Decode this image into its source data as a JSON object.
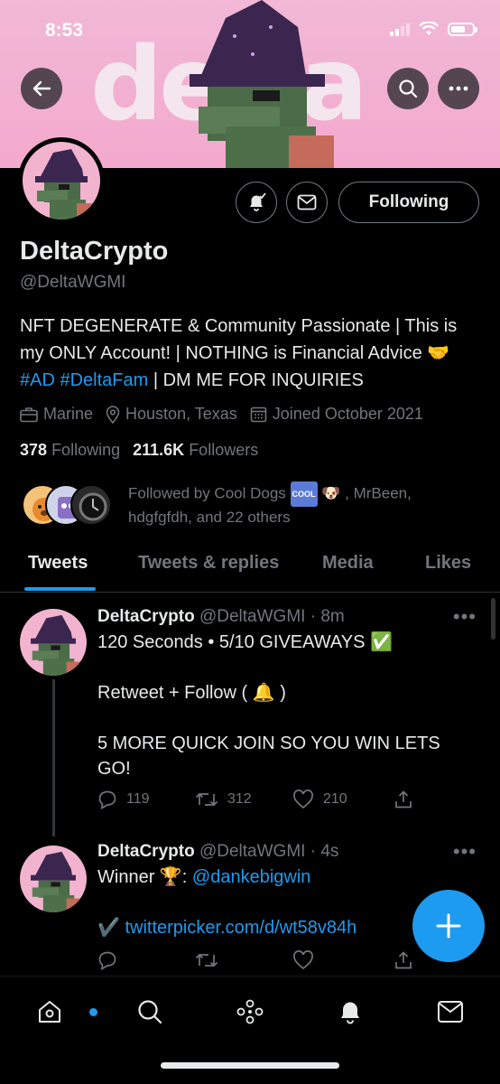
{
  "status_bar": {
    "time": "8:53"
  },
  "banner": {
    "word": "delta"
  },
  "profile": {
    "name": "DeltaCrypto",
    "handle": "@DeltaWGMI",
    "follow_button": "Following",
    "bio_line1": "NFT DEGENERATE & Community Passionate | This is my ONLY Account! | NOTHING is Financial Advice 🤝",
    "bio_tag1": "#AD",
    "bio_tag2": "#DeltaFam",
    "bio_rest": " | DM ME FOR INQUIRIES",
    "category": "Marine",
    "location": "Houston, Texas",
    "joined": "Joined October 2021",
    "following_count": "378",
    "following_label": "Following",
    "followers_count": "211.6K",
    "followers_label": "Followers",
    "followed_by_prefix": "Followed by Cool Dogs ",
    "followed_by_badge": "COOL",
    "followed_by_suffix": "🐶 , MrBeen, hdgfgfdh, and 22 others"
  },
  "tabs": [
    "Tweets",
    "Tweets & replies",
    "Media",
    "Likes"
  ],
  "tweets": [
    {
      "name": "DeltaCrypto",
      "meta": "@DeltaWGMI · 8m",
      "line1": "120 Seconds • 5/10 GIVEAWAYS ✅",
      "line2": "Retweet + Follow ( 🔔 )",
      "line3": "5 MORE QUICK JOIN SO YOU WIN LETS GO!",
      "replies": "119",
      "retweets": "312",
      "likes": "210"
    },
    {
      "name": "DeltaCrypto",
      "meta": "@DeltaWGMI · 4s",
      "line1_text": "Winner 🏆: ",
      "line1_mention": "@dankebigwin",
      "line2_check": "✔️ ",
      "line2_link": "twitterpicker.com/d/wt58v84h"
    }
  ],
  "colors": {
    "accent": "#1d9bf0",
    "banner": "#f2b8d6",
    "muted": "#71767b"
  }
}
